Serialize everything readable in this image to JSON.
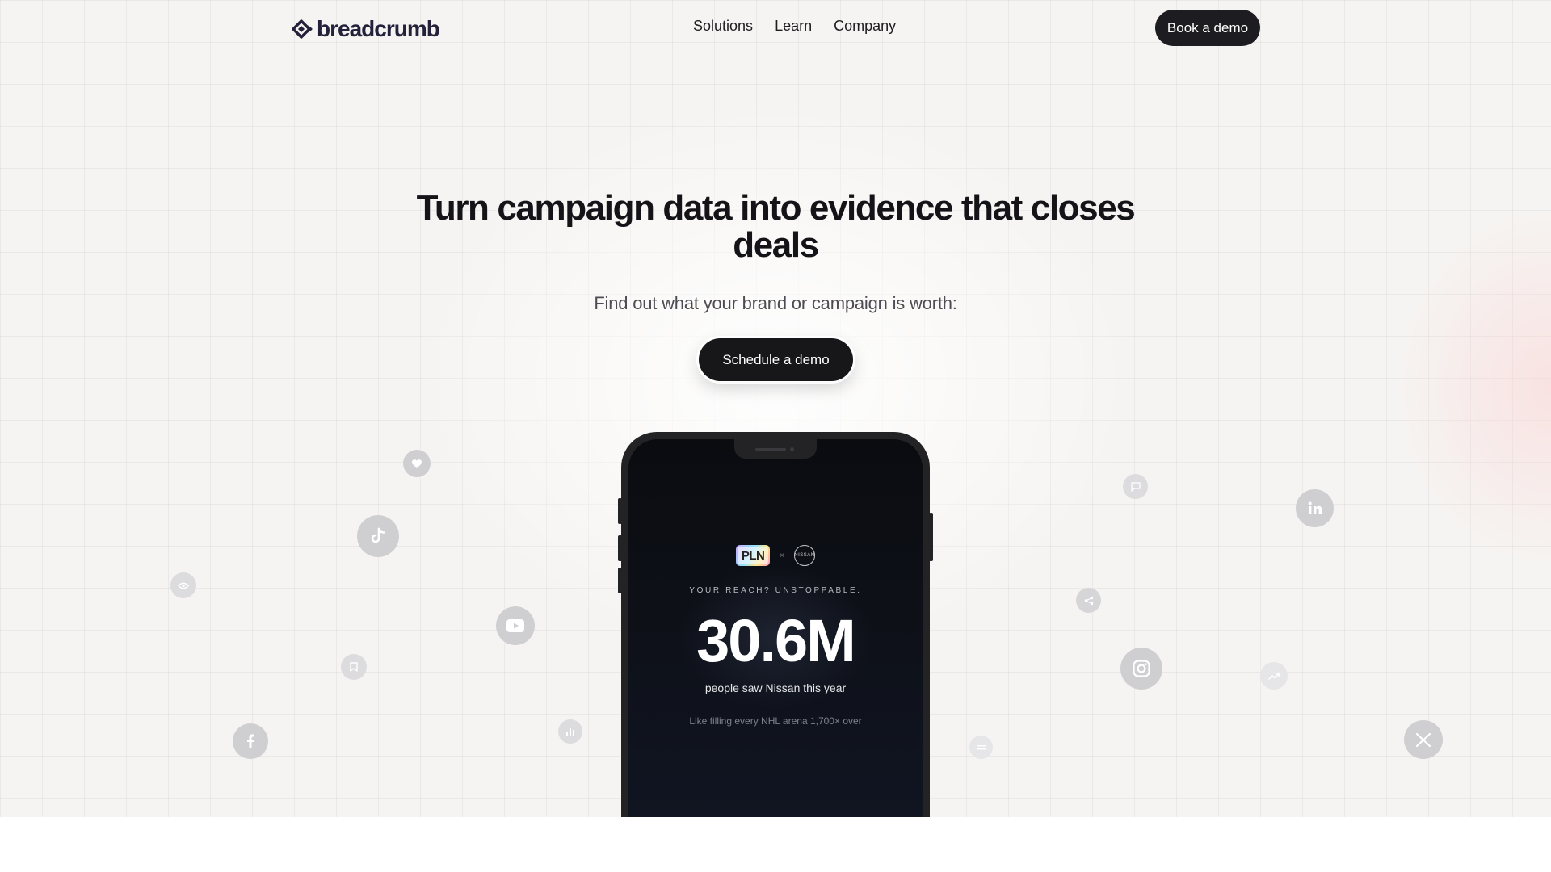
{
  "nav": {
    "logo_text": "breadcrumb",
    "links": [
      "Solutions",
      "Learn",
      "Company"
    ],
    "book_demo": "Book a demo"
  },
  "hero": {
    "headline": "Turn campaign data into evidence that closes deals",
    "subheadline": "Find out what your brand or campaign is worth:",
    "cta": "Schedule a demo"
  },
  "phone": {
    "brand_left": "PLN",
    "separator": "×",
    "brand_right": "NISSAN",
    "tagline": "YOUR REACH? UNSTOPPABLE.",
    "metric": "30.6M",
    "metric_caption": "people saw Nissan this year",
    "comparison": "Like filling every NHL arena 1,700× over"
  },
  "floating_icons": [
    "heart-icon",
    "tiktok-icon",
    "eye-icon",
    "youtube-icon",
    "bookmark-icon",
    "facebook-icon",
    "bar-chart-icon",
    "comment-icon",
    "linkedin-icon",
    "share-icon",
    "instagram-icon",
    "trending-icon",
    "x-icon",
    "more-icon"
  ],
  "colors": {
    "dark": "#17171a",
    "bubble": "#cfcfd1",
    "logo": "#24213a"
  }
}
